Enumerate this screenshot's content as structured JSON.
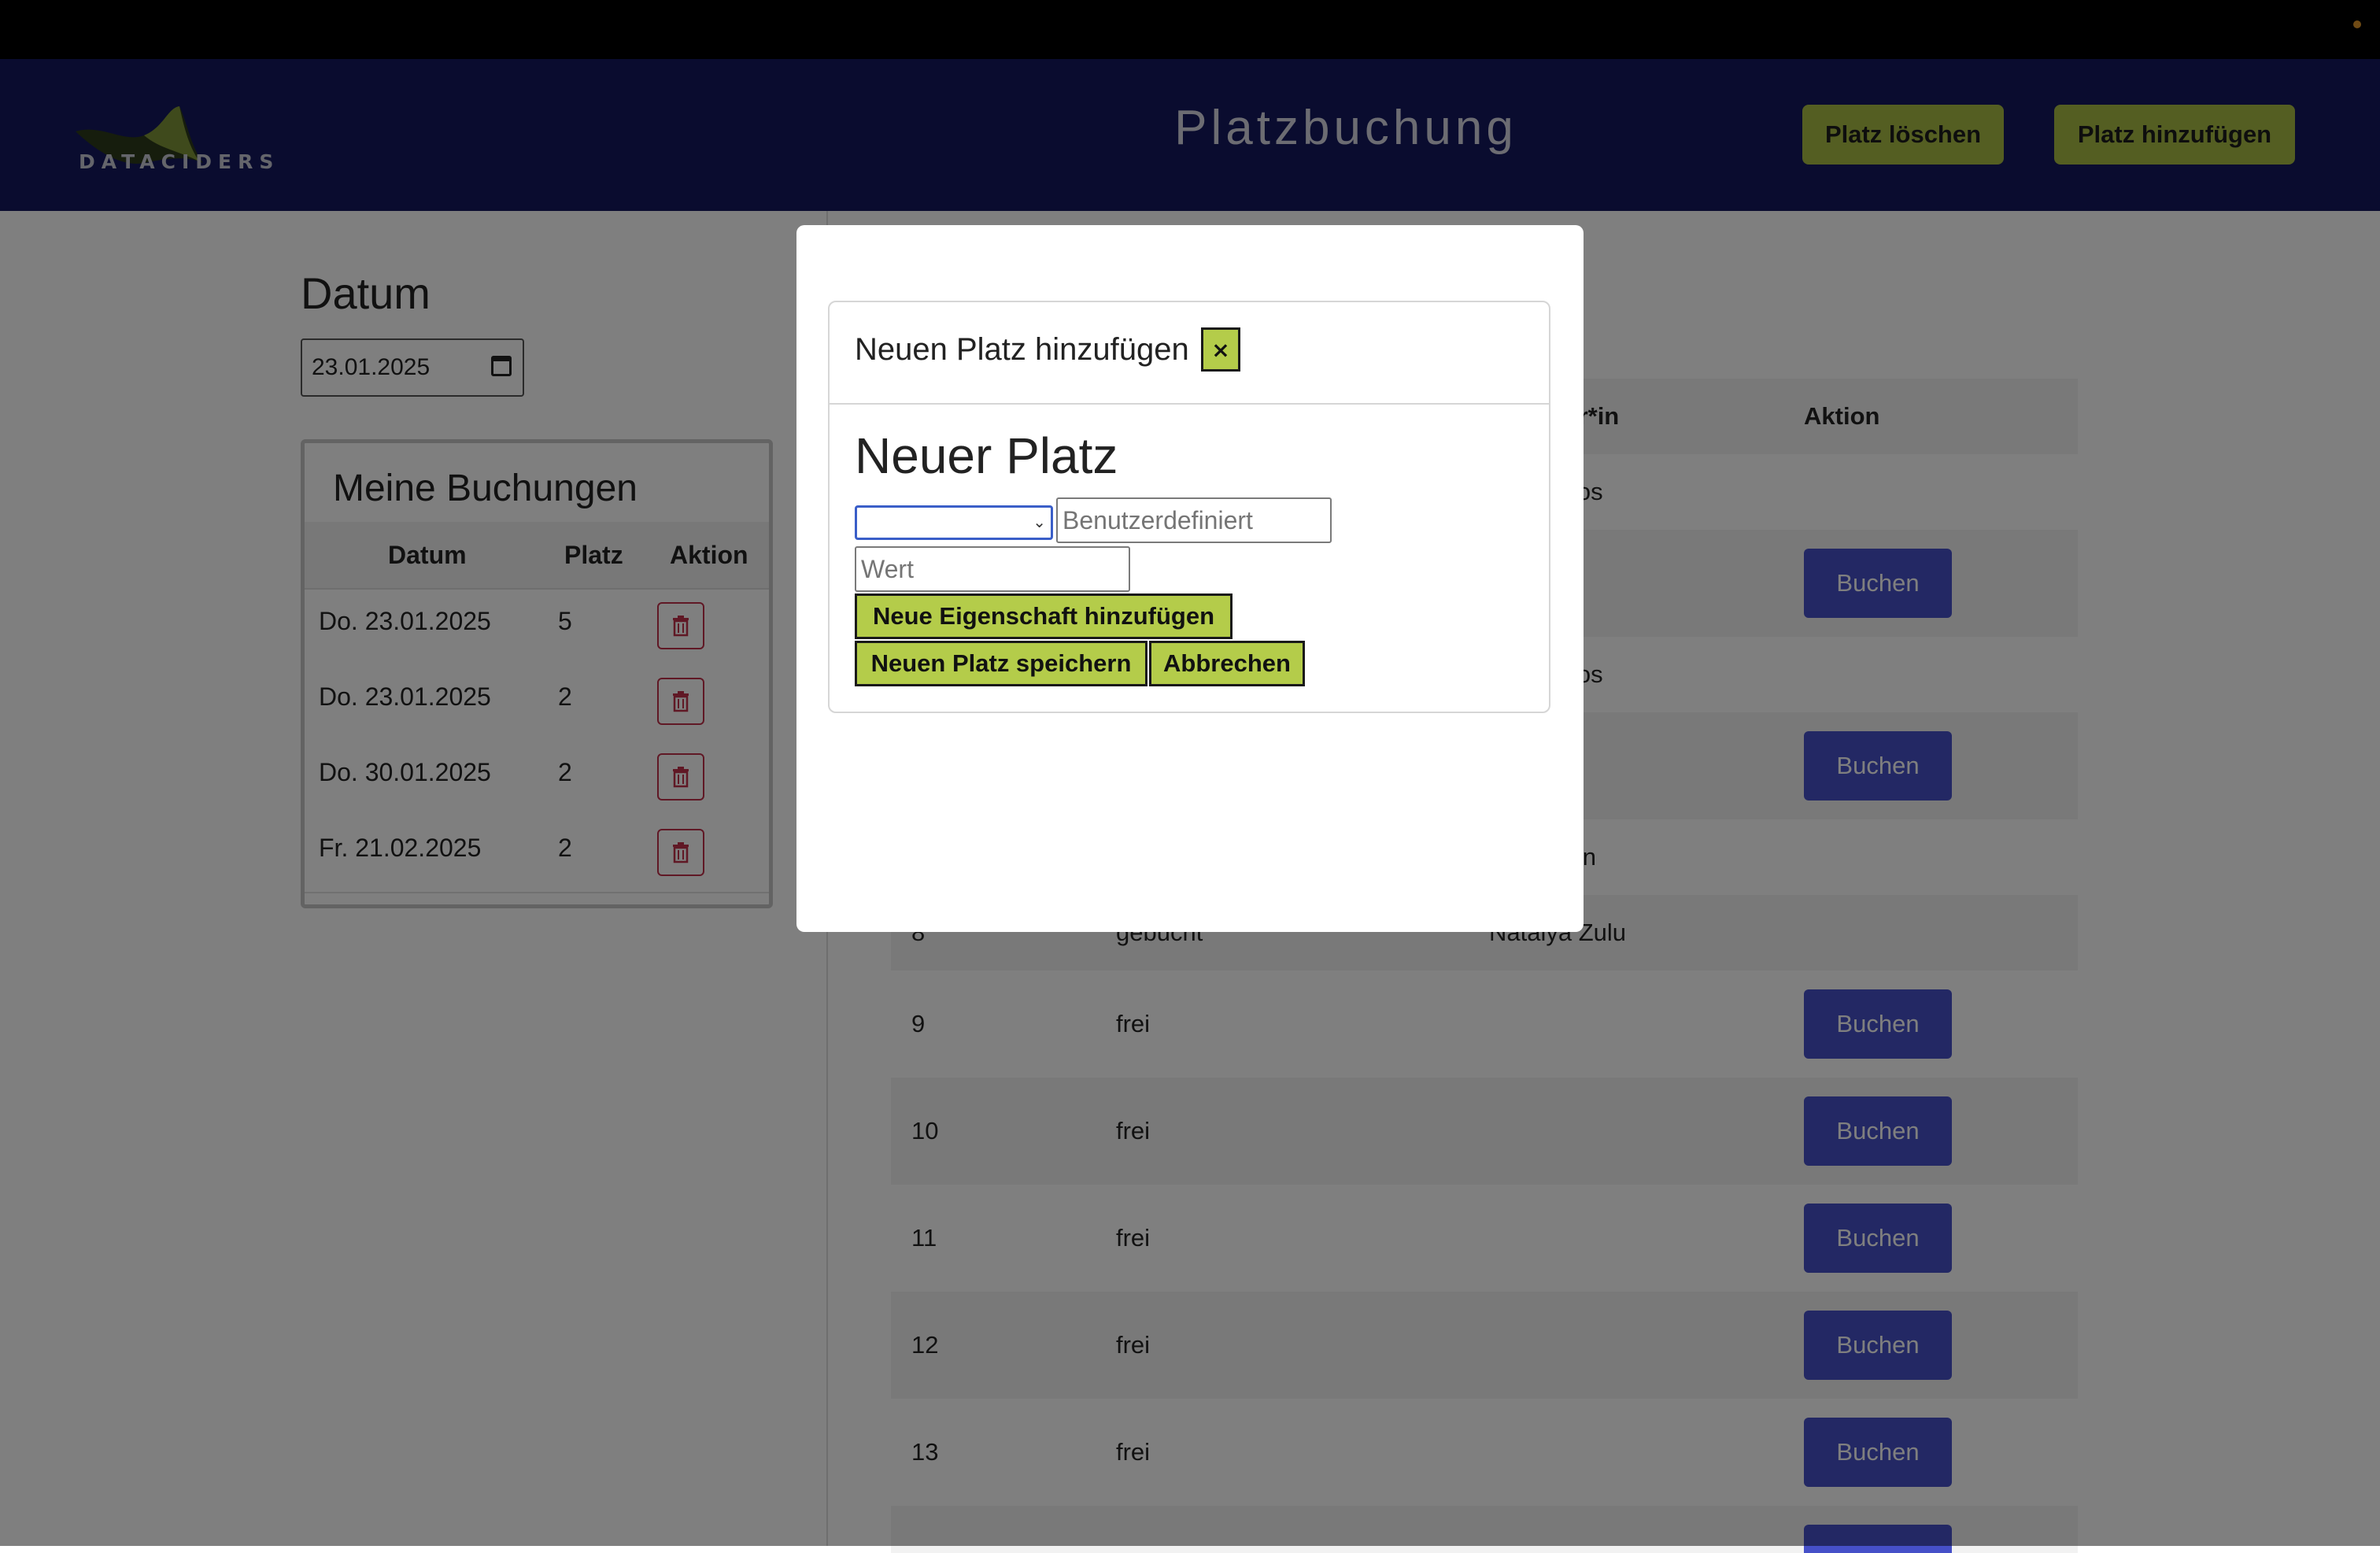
{
  "header": {
    "logo_text": "DATACIDERS",
    "title": "Platzbuchung",
    "delete_button": "Platz löschen",
    "add_button": "Platz hinzufügen",
    "brand_color": "#14185e",
    "accent_color": "#a9bc44"
  },
  "left": {
    "datum_label": "Datum",
    "date_value": "23.01.2025",
    "bookings": {
      "title": "Meine Buchungen",
      "columns": [
        "Datum",
        "Platz",
        "Aktion"
      ],
      "rows": [
        {
          "datum": "Do. 23.01.2025",
          "platz": "5"
        },
        {
          "datum": "Do. 23.01.2025",
          "platz": "2"
        },
        {
          "datum": "Do. 30.01.2025",
          "platz": "2"
        },
        {
          "datum": "Fr. 21.02.2025",
          "platz": "2"
        }
      ]
    }
  },
  "table": {
    "header_visible": [
      "ter*in",
      "Aktion"
    ],
    "rows": [
      {
        "platz": "",
        "status": "",
        "person": "ntos",
        "action": ""
      },
      {
        "platz": "",
        "status": "",
        "person": "",
        "action": "Buchen"
      },
      {
        "platz": "",
        "status": "",
        "person": "ntos",
        "action": ""
      },
      {
        "platz": "",
        "status": "",
        "person": "",
        "action": "Buchen"
      },
      {
        "platz": "",
        "status": "",
        "person": "yen",
        "action": ""
      },
      {
        "platz": "8",
        "status": "gebucht",
        "person": "Natalya Zulu",
        "action": ""
      },
      {
        "platz": "9",
        "status": "frei",
        "person": "",
        "action": "Buchen"
      },
      {
        "platz": "10",
        "status": "frei",
        "person": "",
        "action": "Buchen"
      },
      {
        "platz": "11",
        "status": "frei",
        "person": "",
        "action": "Buchen"
      },
      {
        "platz": "12",
        "status": "frei",
        "person": "",
        "action": "Buchen"
      },
      {
        "platz": "13",
        "status": "frei",
        "person": "",
        "action": "Buchen"
      }
    ],
    "button_color": "#4650c8"
  },
  "modal": {
    "title": "Neuen Platz hinzufügen",
    "close_label": "×",
    "heading": "Neuer Platz",
    "select_value": "",
    "custom_placeholder": "Benutzerdefiniert",
    "value_placeholder": "Wert",
    "add_property_button": "Neue Eigenschaft hinzufügen",
    "save_button": "Neuen Platz speichern",
    "cancel_button": "Abbrechen"
  }
}
